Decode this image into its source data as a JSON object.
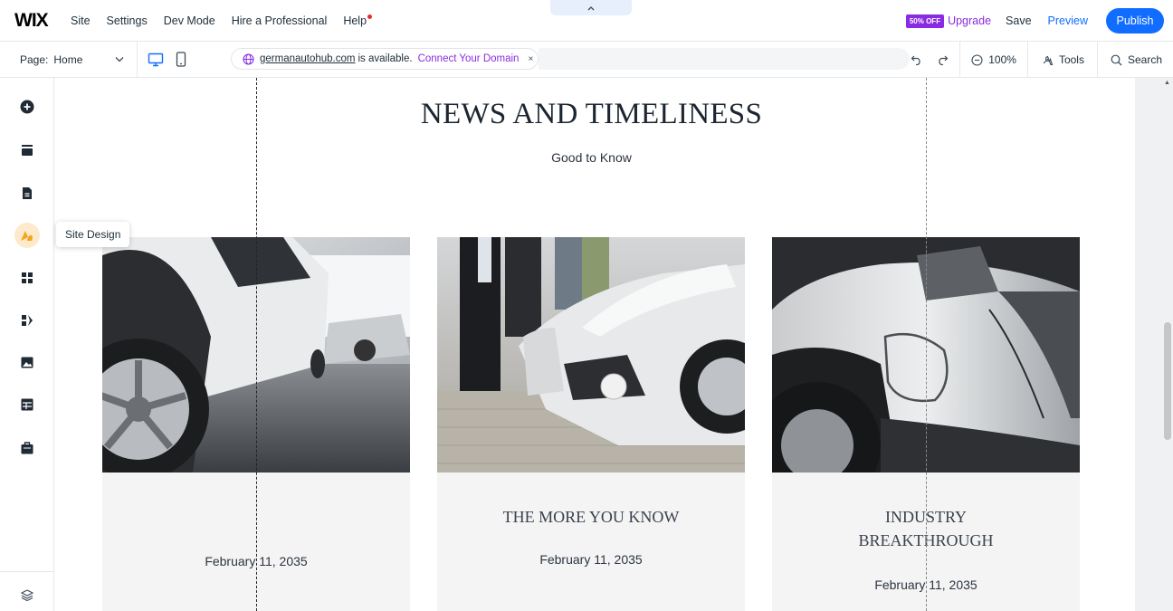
{
  "topbar": {
    "logo": "WIX",
    "menu": [
      "Site",
      "Settings",
      "Dev Mode",
      "Hire a Professional",
      "Help"
    ],
    "collapse_icon": "chevron-up-icon",
    "sale_badge": "50% OFF",
    "upgrade": "Upgrade",
    "save": "Save",
    "preview": "Preview",
    "publish": "Publish"
  },
  "subbar": {
    "page_label": "Page:",
    "page_name": "Home",
    "domain_url": "germanautohub.com",
    "domain_available": "is available.",
    "domain_connect": "Connect Your Domain",
    "domain_close": "×",
    "zoom": "100%",
    "tools": "Tools",
    "search": "Search"
  },
  "leftbar": {
    "icons": [
      "add-icon",
      "sections-icon",
      "pages-icon",
      "site-design-icon",
      "apps-icon",
      "app-market-icon",
      "media-icon",
      "cms-icon",
      "business-icon"
    ],
    "tooltip": "Site Design",
    "layers_icon": "layers-icon"
  },
  "page": {
    "heading": "NEWS AND TIMELINESS",
    "subheading": "Good to Know",
    "cards": [
      {
        "title": "",
        "date": "February 11, 2035"
      },
      {
        "title": "THE MORE YOU KNOW",
        "date": "February 11, 2035"
      },
      {
        "title": "INDUSTRY BREAKTHROUGH",
        "title_line1": "INDUSTRY",
        "title_line2": "BREAKTHROUGH",
        "date": "February 11, 2035"
      }
    ]
  },
  "colors": {
    "accent": "#116dff",
    "upgrade": "#8a2be2",
    "active_tool": "#fde9cc"
  }
}
